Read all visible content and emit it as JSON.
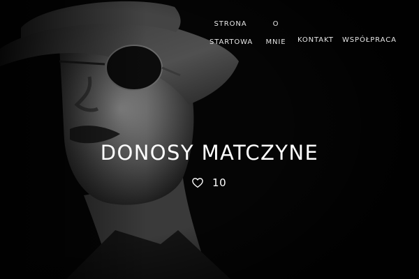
{
  "nav": {
    "items": [
      {
        "line1": "STRONA",
        "line2": "STARTOWA"
      },
      {
        "line1": "O",
        "line2": "MNIE"
      },
      {
        "label": "KONTAKT"
      },
      {
        "label": "WSPÓŁPRACA"
      }
    ]
  },
  "post": {
    "title": "DONOSY MATCZYNE",
    "likes": "10"
  },
  "icons": {
    "like": "heart-outline-icon"
  },
  "colors": {
    "background": "#050505",
    "text": "#ffffff"
  }
}
